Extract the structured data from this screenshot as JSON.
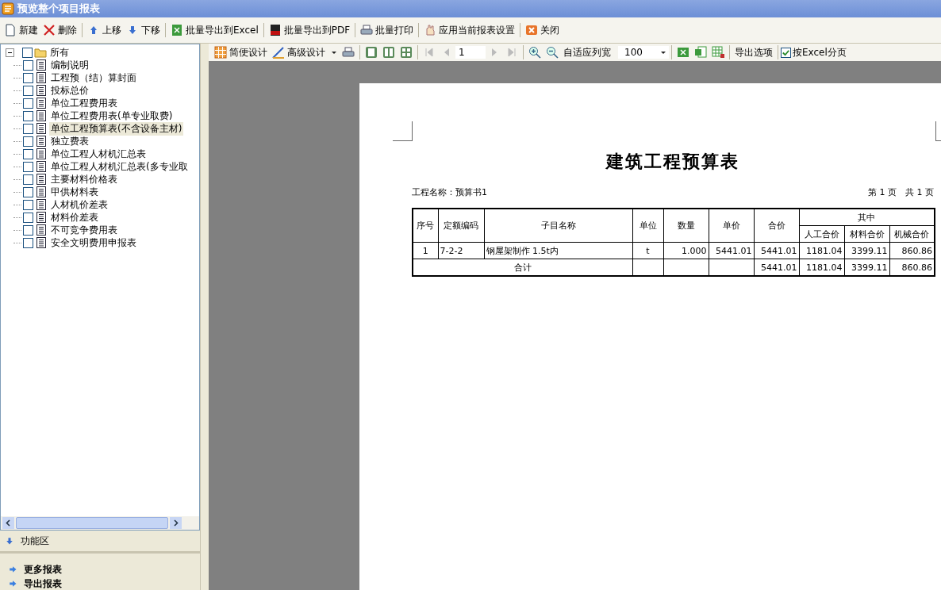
{
  "window": {
    "title": "预览整个项目报表"
  },
  "toolbar": [
    {
      "label": "新建"
    },
    {
      "label": "删除"
    },
    {
      "label": "上移"
    },
    {
      "label": "下移"
    },
    {
      "label": "批量导出到Excel"
    },
    {
      "label": "批量导出到PDF"
    },
    {
      "label": "批量打印"
    },
    {
      "label": "应用当前报表设置"
    },
    {
      "label": "关闭"
    }
  ],
  "tree": {
    "label": "所有",
    "expanded": true,
    "checked": false,
    "children": [
      {
        "label": "编制说明",
        "checked": false,
        "selected": false
      },
      {
        "label": "工程预（结）算封面",
        "checked": false,
        "selected": false
      },
      {
        "label": "投标总价",
        "checked": false,
        "selected": false
      },
      {
        "label": "单位工程费用表",
        "checked": false,
        "selected": false
      },
      {
        "label": "单位工程费用表(单专业取费)",
        "checked": false,
        "selected": false
      },
      {
        "label": "单位工程预算表(不含设备主材)",
        "checked": false,
        "selected": true
      },
      {
        "label": "独立费表",
        "checked": false,
        "selected": false
      },
      {
        "label": "单位工程人材机汇总表",
        "checked": false,
        "selected": false
      },
      {
        "label": "单位工程人材机汇总表(多专业取",
        "checked": false,
        "selected": false
      },
      {
        "label": "主要材料价格表",
        "checked": false,
        "selected": false
      },
      {
        "label": "甲供材料表",
        "checked": false,
        "selected": false
      },
      {
        "label": "人材机价差表",
        "checked": false,
        "selected": false
      },
      {
        "label": "材料价差表",
        "checked": false,
        "selected": false
      },
      {
        "label": "不可竞争费用表",
        "checked": false,
        "selected": false
      },
      {
        "label": "安全文明费用申报表",
        "checked": false,
        "selected": false
      }
    ]
  },
  "function_area": {
    "label": "功能区"
  },
  "more": [
    {
      "label": "更多报表"
    },
    {
      "label": "导出报表"
    }
  ],
  "preview_toolbar": {
    "simple_design": "简便设计",
    "advanced_design": "高级设计",
    "page": "1",
    "fit_columns": "自适应列宽",
    "zoom": "100",
    "export_options": "导出选项",
    "excel_paging": {
      "label": "按Excel分页",
      "checked": true
    }
  },
  "report": {
    "title": "建筑工程预算表",
    "project": "工程名称：预算书1",
    "page_info": "第 1 页　共 1 页",
    "headers": [
      "序号",
      "定额编码",
      "子目名称",
      "单位",
      "数量",
      "单价",
      "合价"
    ],
    "group_header": "其中",
    "sub_headers": [
      "人工合价",
      "材料合价",
      "机械合价"
    ],
    "rows": [
      [
        "1",
        "7-2-2",
        "钢屋架制作 1.5t内",
        "t",
        "1.000",
        "5441.01",
        "5441.01",
        "1181.04",
        "3399.11",
        "860.86"
      ]
    ],
    "total": {
      "label": "合计",
      "cells": [
        "",
        "",
        "",
        "5441.01",
        "1181.04",
        "3399.11",
        "860.86"
      ]
    }
  }
}
